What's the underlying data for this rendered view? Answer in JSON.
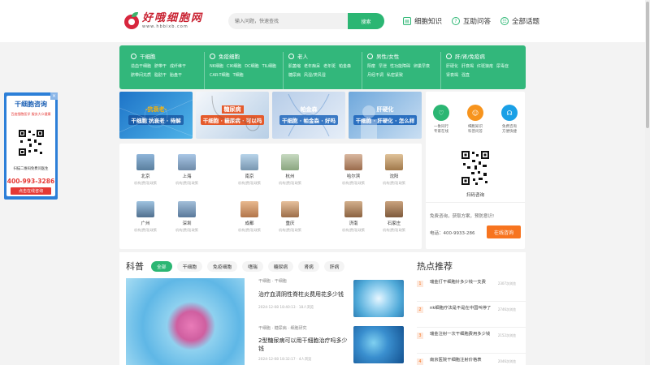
{
  "logo": {
    "cn": "好哦细胞网",
    "url": "www.hbbixb.com"
  },
  "search": {
    "placeholder": "输入问题，快速查找",
    "button": "搜索"
  },
  "topnav": [
    {
      "label": "细胞知识",
      "icon": "book-icon"
    },
    {
      "label": "互助问答",
      "icon": "question-icon"
    },
    {
      "label": "全部话题",
      "icon": "topic-icon"
    }
  ],
  "categories": [
    {
      "title": "干细胞",
      "links": [
        "造血干细胞",
        "脐带干",
        "成纤维干",
        "脐带间充质",
        "脂肪干",
        "胎盘干"
      ]
    },
    {
      "title": "免疫细胞",
      "links": [
        "NK细胞",
        "CIK细胞",
        "DC细胞",
        "TIL细胞",
        "CAR-T细胞",
        "T细胞"
      ]
    },
    {
      "title": "老人",
      "links": [
        "肌萎缩",
        "老年痴呆",
        "老年斑",
        "帕金森",
        "糖尿病",
        "风湿/类风湿"
      ]
    },
    {
      "title": "男性/女性",
      "links": [
        "阳痿",
        "早泄",
        "性功能障碍",
        "卵巢早衰",
        "月经不调",
        "私密紧致"
      ]
    },
    {
      "title": "肝/肾/免疫病",
      "links": [
        "肝硬化",
        "肝衰竭",
        "红斑狼疮",
        "尿毒症",
        "肾衰竭",
        "强直"
      ]
    }
  ],
  "banners": [
    {
      "t1": "-抗衰老-",
      "t2": "干细胞 抗衰老 · 待解"
    },
    {
      "t1": "糖尿病",
      "t2": "干细胞 · 糖尿病 · 可以吗"
    },
    {
      "t1": "帕金森",
      "t2": "干细胞 · 帕金森 · 好吗"
    },
    {
      "t1": "肝硬化",
      "t2": "干细胞 · 肝硬化 · 怎么样"
    }
  ],
  "cities": [
    {
      "name": "北京",
      "sub": "机构|费用|政策"
    },
    {
      "name": "上海",
      "sub": "机构|费用|政策"
    },
    {
      "name": "南京",
      "sub": "机构|费用|政策"
    },
    {
      "name": "杭州",
      "sub": "机构|费用|政策"
    },
    {
      "name": "哈尔滨",
      "sub": "机构|费用|政策"
    },
    {
      "name": "沈阳",
      "sub": "机构|费用|政策"
    },
    {
      "name": "广州",
      "sub": "机构|费用|政策"
    },
    {
      "name": "深圳",
      "sub": "机构|费用|政策"
    },
    {
      "name": "成都",
      "sub": "机构|费用|政策"
    },
    {
      "name": "重庆",
      "sub": "机构|费用|政策"
    },
    {
      "name": "济南",
      "sub": "机构|费用|政策"
    },
    {
      "name": "石家庄",
      "sub": "机构|费用|政策"
    }
  ],
  "services": [
    {
      "l1": "一象同行",
      "l2": "专家在线",
      "color": "#2bb673"
    },
    {
      "l1": "细胞知识",
      "l2": "科普问答",
      "color": "#f7941d"
    },
    {
      "l1": "免费咨询",
      "l2": "方便快捷",
      "color": "#1aa0e6"
    }
  ],
  "right": {
    "qr_caption": "扫码咨询",
    "free_text": "免费咨询，获取方案，预防意识!",
    "phone": "电话：400-9933-286",
    "consult_button": "在线咨询"
  },
  "science": {
    "title": "科普",
    "tabs": [
      "全部",
      "干细胞",
      "免疫细胞",
      "嗜瑞",
      "糖尿病",
      "肾病",
      "肝病"
    ],
    "articles": [
      {
        "tags": "干细胞 · 干细胞",
        "title": "治疗血清阴性脊柱炎费用花多少钱",
        "meta": "2024-12-08 18:40:13 · 18人浏览"
      },
      {
        "tags": "干细胞 · 糖尿病 · 细胞研究",
        "title": "2型糖尿病可以用干细胞治疗吗多少钱",
        "meta": "2024-12-08 18:32:17 · 4人浏览"
      }
    ]
  },
  "hot": {
    "title": "热点推荐",
    "items": [
      {
        "n": "1",
        "text": "瑞金打干细胞针多少钱一支费",
        "count": "2307次浏览"
      },
      {
        "n": "2",
        "text": "nk细胞疗法是不是在中国叫停了",
        "count": "2746次浏览"
      },
      {
        "n": "3",
        "text": "瑞金注射一次干细胞费用多少钱",
        "count": "2152次浏览"
      },
      {
        "n": "4",
        "text": "南京医院干细胞注射价格表",
        "count": "2046次浏览"
      }
    ]
  },
  "float": {
    "title": "干细胞咨询",
    "sub": "百度细胞医学 服务大众健康",
    "scan": "扫描二维码免费问医生",
    "phone": "400-993-3286",
    "button": "点击在线咨询",
    "close": "×"
  }
}
